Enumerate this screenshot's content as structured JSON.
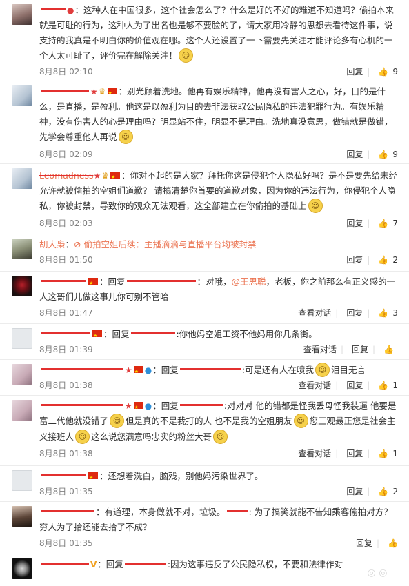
{
  "actions": {
    "reply": "回复",
    "view_dialog": "查看对话",
    "like_icon": "👍"
  },
  "comments": [
    {
      "time": "8月8日 02:10",
      "likes": "9",
      "segments": [
        "：这种人在中国很多，这个社会怎么了？什么是好的不好的难道不知道吗？偷拍本来就是可耻的行为，这种人为了出名也是够不要脸的了，请大家用冷静的思想去看待这件事，说支持的我真是不明白你的价值观在哪。这个人还设置了一下需要先关注才能评论多有心机的一个人太可耻了，评价完在解除关注！"
      ]
    },
    {
      "time": "8月8日 02:09",
      "likes": "9",
      "segments": [
        "：别光顾着洗地。他再有娱乐精神，他再没有害人之心，好，目的是什么，是直播，是盈利。他这是以盈利为目的去非法获取公民隐私的违法犯罪行为。有娱乐精神，没有伤害人的心是理由吗？明显站不住，明显不是理由。洗地真没意思，做错就是做错，先学会尊重他人再说"
      ]
    },
    {
      "time": "8月8日 02:03",
      "likes": "7",
      "username_visible": "Leomadness",
      "segments": [
        "：你对不起的是大家？拜托你这是侵犯个人隐私好吗？是不是要先给未经允许就被偷拍的空姐们道歉？ 请搞清楚你首要的道歉对象，因为你的违法行为，你侵犯个人隐私，你被封禁，导致你的观众无法观看，这全部建立在你偷拍的基础上"
      ]
    },
    {
      "time": "8月8日 01:50",
      "likes": "2",
      "username_visible": "胡大枭",
      "segments": [
        "：",
        "偷拍空姐后续：主播滴滴与直播平台均被封禁"
      ]
    },
    {
      "time": "8月8日 01:47",
      "likes": "3",
      "segments": [
        "：回复",
        "：对哦，",
        "@王思聪",
        "，老板，你之前那么有正义感的一人这哥们儿做这事儿你可别不管哈"
      ]
    },
    {
      "time": "8月8日 01:39",
      "likes": "",
      "segments": [
        "：回复",
        ":你他妈空姐工资不他妈用你几条街。"
      ]
    },
    {
      "time": "8月8日 01:38",
      "likes": "1",
      "segments": [
        "：回复",
        ":可是还有人在喷我",
        "泪目无言"
      ]
    },
    {
      "time": "8月8日 01:38",
      "likes": "1",
      "segments": [
        "：回复",
        ":对对对 他的错都是怪我丢母怪我装逼 他要是富二代他就没错了",
        "但是真的不是我打的人 也不是我的空姐朋友",
        "您三观最正您是社会主义接班人",
        "这么说您满意吗忠实的粉丝大哥"
      ]
    },
    {
      "time": "8月8日 01:35",
      "likes": "2",
      "segments": [
        "：还想着洗白，脑残，别他妈污染世界了。"
      ]
    },
    {
      "time": "8月8日 01:35",
      "likes": "",
      "segments": [
        "：有道理，本身做就不对，垃圾。",
        ": 为了搞笑就能不告知乘客偷拍对方？穷人为了拾还能去拾了不成？"
      ]
    },
    {
      "time": "",
      "likes": "",
      "segments": [
        "：回复",
        ":因为这事违反了公民隐私权，不要和法律作对"
      ]
    }
  ]
}
